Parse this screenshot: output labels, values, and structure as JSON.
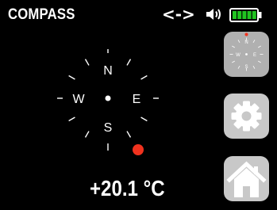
{
  "header": {
    "title": "COMPASS",
    "link_status": "<->",
    "icons": {
      "sound": "speaker-icon",
      "battery": "battery-icon"
    },
    "battery_level": 1.0,
    "battery_color": "#21c521"
  },
  "compass": {
    "directions": {
      "north": "N",
      "east": "E",
      "south": "S",
      "west": "W"
    },
    "needle_color": "#f0321e"
  },
  "temperature": "+20.1 °C",
  "sidebar": {
    "buttons": [
      {
        "name": "mini-compass-button",
        "icon": "compass-icon"
      },
      {
        "name": "settings-button",
        "icon": "gear-icon"
      },
      {
        "name": "home-button",
        "icon": "home-icon"
      }
    ]
  },
  "colors": {
    "background": "#000000",
    "foreground": "#ffffff",
    "button": "#c8c8c8",
    "accent": "#f0321e"
  }
}
